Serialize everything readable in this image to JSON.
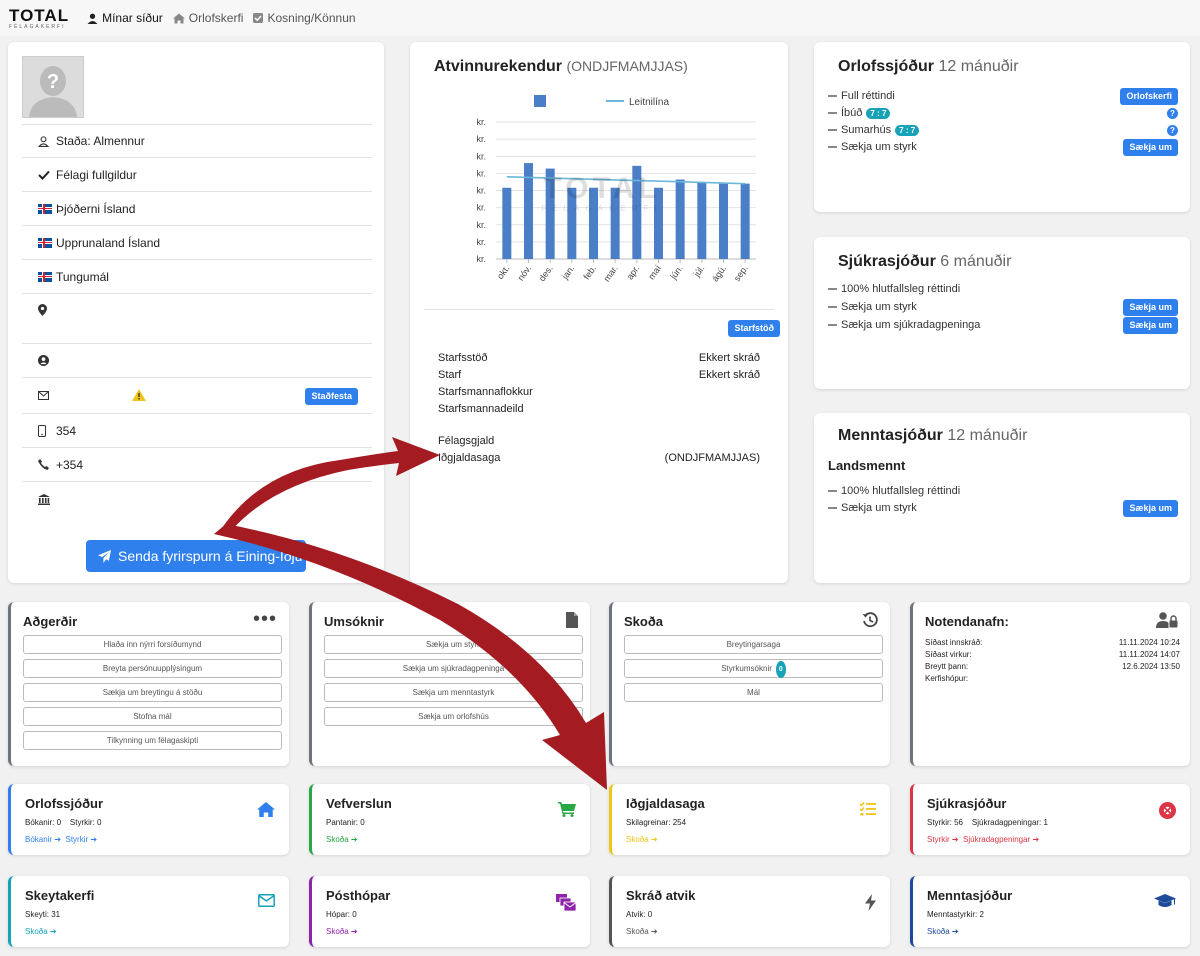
{
  "nav": {
    "logo_text": "TOTAL",
    "logo_sub": "FÉLAGAKERFI",
    "items": [
      {
        "label": "Mínar síður",
        "icon": "user-icon"
      },
      {
        "label": "Orlofskerfi",
        "icon": "home-icon"
      },
      {
        "label": "Kosning/Könnun",
        "icon": "checkbox-icon"
      }
    ]
  },
  "profile": {
    "rows": [
      {
        "label": "Staða: Almennur",
        "icon": "user-outline-icon"
      },
      {
        "label": "Félagi fullgildur",
        "icon": "check-icon"
      },
      {
        "label": "Þjóðerni Ísland",
        "icon": "iceland-flag-icon"
      },
      {
        "label": "Upprunaland Ísland",
        "icon": "iceland-flag-icon"
      },
      {
        "label": "Tungumál",
        "icon": "iceland-flag-icon"
      },
      {
        "label": "",
        "icon": "map-marker-icon"
      },
      {
        "label": "",
        "icon": "user-circle-icon"
      },
      {
        "label": "",
        "icon": "envelope-icon"
      },
      {
        "label": "354",
        "icon": "mobile-icon"
      },
      {
        "label": "+354",
        "icon": "phone-icon"
      },
      {
        "label": "",
        "icon": "bank-icon"
      }
    ],
    "confirm_button": "Staðfesta",
    "send_button": "Senda fyrirspurn á Eining-Iðju"
  },
  "employer": {
    "title": "Atvinnurekendur",
    "title_suffix": "(ONDJFMAMJJAS)",
    "workplace_button": "Starfstöð",
    "details": [
      {
        "label": "Starfsstöð",
        "value": "Ekkert skráð"
      },
      {
        "label": "Starf",
        "value": "Ekkert skráð"
      },
      {
        "label": "Starfsmannaflokkur",
        "value": ""
      },
      {
        "label": "Starfsmannadeild",
        "value": ""
      },
      {
        "label": "Félagsgjald",
        "value": ""
      },
      {
        "label": "Iðgjaldasaga",
        "value": "(ONDJFMAMJJAS)"
      }
    ],
    "watermark": "TOTAL",
    "watermark_sub": "FÉLAGAKERFI"
  },
  "chart_data": {
    "type": "bar",
    "legend": [
      "",
      "Leitnilína"
    ],
    "categories": [
      "okt.",
      "nóv.",
      "des.",
      "jan.",
      "feb.",
      "mar.",
      "apr.",
      "maí",
      "jún.",
      "júl.",
      "ágú.",
      "sep."
    ],
    "values": [
      0.52,
      0.7,
      0.66,
      0.52,
      0.52,
      0.52,
      0.68,
      0.52,
      0.58,
      0.56,
      0.55,
      0.55
    ],
    "trend": [
      0.6,
      0.55
    ],
    "ylim": [
      0,
      1
    ],
    "ytick_labels": [
      "kr.",
      "kr.",
      "kr.",
      "kr.",
      "kr.",
      "kr.",
      "kr.",
      "kr.",
      "kr."
    ],
    "colors": {
      "bar": "#4a7fc8",
      "trend": "#6ab7d9"
    },
    "grid": true
  },
  "orlof": {
    "title": "Orlofssjóður",
    "period": "12 mánuðir",
    "rows": [
      {
        "label": "Full réttindi",
        "badge": "",
        "button": "Orlofskerfi",
        "help": false
      },
      {
        "label": "Íbúð",
        "badge": "7 : 7",
        "button": "",
        "help": true
      },
      {
        "label": "Sumarhús",
        "badge": "7 : 7",
        "button": "",
        "help": true
      },
      {
        "label": "Sækja um styrk",
        "badge": "",
        "button": "Sækja um",
        "help": false
      }
    ]
  },
  "sjukra": {
    "title": "Sjúkrasjóður",
    "period": "6 mánuðir",
    "rows": [
      {
        "label": "100% hlutfallsleg réttindi",
        "button": ""
      },
      {
        "label": "Sækja um styrk",
        "button": "Sækja um"
      },
      {
        "label": "Sækja um sjúkradagpeninga",
        "button": "Sækja um"
      }
    ]
  },
  "mennta": {
    "title": "Menntasjóður",
    "period": "12 mánuðir",
    "subtitle": "Landsmennt",
    "rows": [
      {
        "label": "100% hlutfallsleg réttindi",
        "button": ""
      },
      {
        "label": "Sækja um styrk",
        "button": "Sækja um"
      }
    ]
  },
  "adgerdir": {
    "title": "Aðgerðir",
    "buttons": [
      "Hlaða inn nýrri forsíðumynd",
      "Breyta persónuupplýsingum",
      "Sækja um breytingu á stöðu",
      "Stofna mál",
      "Tilkynning um félagaskipti"
    ]
  },
  "umsoknir": {
    "title": "Umsóknir",
    "buttons": [
      "Sækja um styrk",
      "Sækja um sjúkradagpeninga",
      "Sækja um menntastyrk",
      "Sækja um orlofshús"
    ]
  },
  "skoda": {
    "title": "Skoða",
    "buttons": [
      "Breytingarsaga",
      "Styrkumsóknir",
      "Mál"
    ],
    "badge": "0"
  },
  "notandi": {
    "title": "Notendanafn:",
    "rows": [
      {
        "label": "Síðast innskráð:",
        "value": "11.11.2024 10:24"
      },
      {
        "label": "Síðast virkur:",
        "value": "11.11.2024 14:07"
      },
      {
        "label": "Breytt þann:",
        "value": "12.6.2024 13:50"
      },
      {
        "label": "Kerfishópur:",
        "value": ""
      }
    ]
  },
  "tiles": [
    {
      "title": "Orlofssjóður",
      "sub": "Bókanir: 0    Styrkir: 0",
      "links": [
        "Bókanir",
        "Styrkir"
      ],
      "icon": "home-icon",
      "color": "#2f80ed"
    },
    {
      "title": "Vefverslun",
      "sub": "Pantanir: 0",
      "links": [
        "Skoða"
      ],
      "icon": "shopping-cart-icon",
      "color": "#28a745"
    },
    {
      "title": "Iðgjaldasaga",
      "sub": "Skilagreinar: 254",
      "links": [
        "Skoða"
      ],
      "icon": "list-check-icon",
      "color": "#f0c419"
    },
    {
      "title": "Sjúkrasjóður",
      "sub": "Styrkir: 56    Sjúkradagpeningar: 1",
      "links": [
        "Styrkir",
        "Sjúkradagpeningar"
      ],
      "icon": "life-ring-icon",
      "color": "#dc3545"
    },
    {
      "title": "Skeytakerfi",
      "sub": "Skeyti: 31",
      "links": [
        "Skoða"
      ],
      "icon": "envelope-icon",
      "color": "#17a2b8"
    },
    {
      "title": "Pósthópar",
      "sub": "Hópar: 0",
      "links": [
        "Skoða"
      ],
      "icon": "mail-bulk-icon",
      "color": "#8e24aa"
    },
    {
      "title": "Skráð atvik",
      "sub": "Atvik: 0",
      "links": [
        "Skoða"
      ],
      "icon": "bolt-icon",
      "color": "#555555"
    },
    {
      "title": "Menntasjóður",
      "sub": "Menntastyrkir: 2",
      "links": [
        "Skoða"
      ],
      "icon": "graduation-cap-icon",
      "color": "#1d4a9b"
    }
  ]
}
